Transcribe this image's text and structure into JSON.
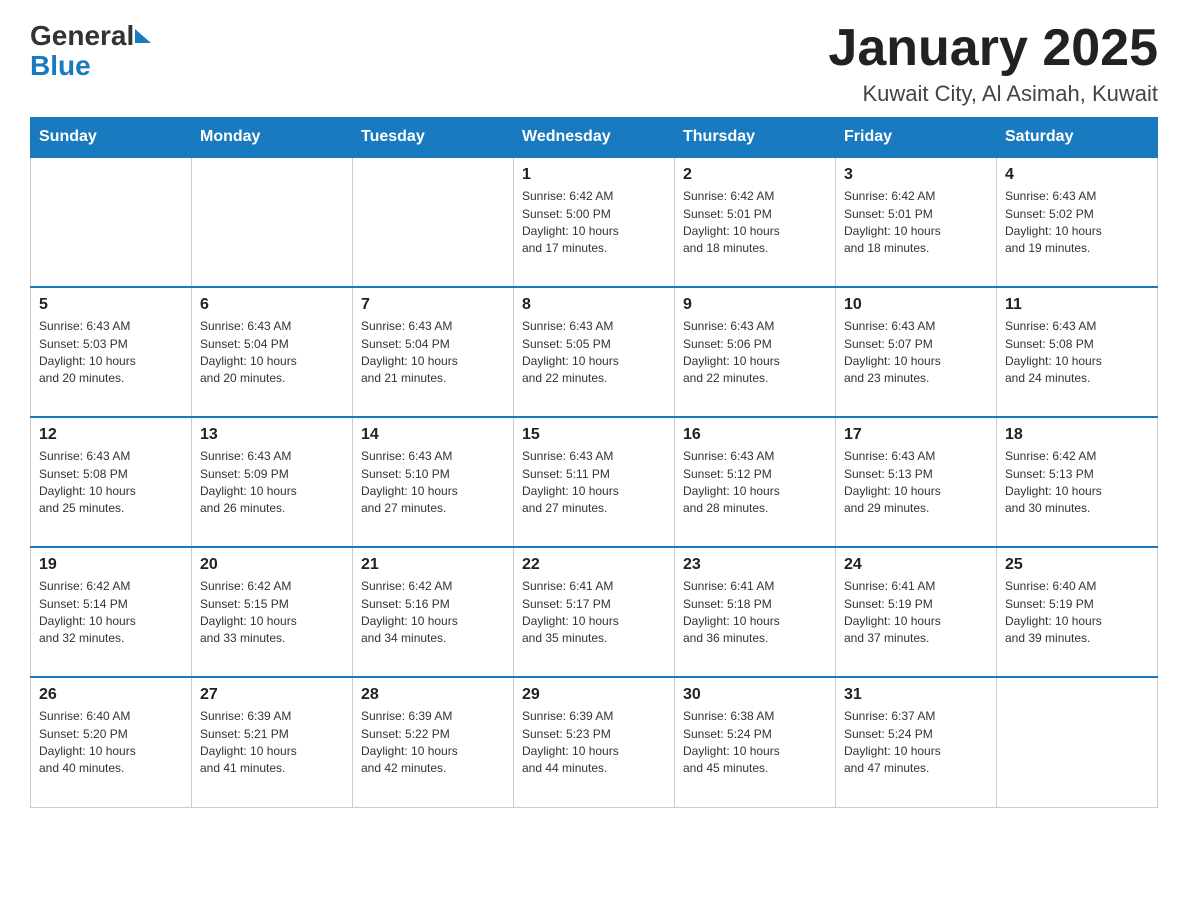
{
  "logo": {
    "text_general": "General",
    "text_blue": "Blue",
    "triangle_alt": "triangle"
  },
  "title": {
    "month": "January 2025",
    "location": "Kuwait City, Al Asimah, Kuwait"
  },
  "days_of_week": [
    "Sunday",
    "Monday",
    "Tuesday",
    "Wednesday",
    "Thursday",
    "Friday",
    "Saturday"
  ],
  "weeks": [
    {
      "cells": [
        {
          "day": "",
          "info": ""
        },
        {
          "day": "",
          "info": ""
        },
        {
          "day": "",
          "info": ""
        },
        {
          "day": "1",
          "info": "Sunrise: 6:42 AM\nSunset: 5:00 PM\nDaylight: 10 hours\nand 17 minutes."
        },
        {
          "day": "2",
          "info": "Sunrise: 6:42 AM\nSunset: 5:01 PM\nDaylight: 10 hours\nand 18 minutes."
        },
        {
          "day": "3",
          "info": "Sunrise: 6:42 AM\nSunset: 5:01 PM\nDaylight: 10 hours\nand 18 minutes."
        },
        {
          "day": "4",
          "info": "Sunrise: 6:43 AM\nSunset: 5:02 PM\nDaylight: 10 hours\nand 19 minutes."
        }
      ]
    },
    {
      "cells": [
        {
          "day": "5",
          "info": "Sunrise: 6:43 AM\nSunset: 5:03 PM\nDaylight: 10 hours\nand 20 minutes."
        },
        {
          "day": "6",
          "info": "Sunrise: 6:43 AM\nSunset: 5:04 PM\nDaylight: 10 hours\nand 20 minutes."
        },
        {
          "day": "7",
          "info": "Sunrise: 6:43 AM\nSunset: 5:04 PM\nDaylight: 10 hours\nand 21 minutes."
        },
        {
          "day": "8",
          "info": "Sunrise: 6:43 AM\nSunset: 5:05 PM\nDaylight: 10 hours\nand 22 minutes."
        },
        {
          "day": "9",
          "info": "Sunrise: 6:43 AM\nSunset: 5:06 PM\nDaylight: 10 hours\nand 22 minutes."
        },
        {
          "day": "10",
          "info": "Sunrise: 6:43 AM\nSunset: 5:07 PM\nDaylight: 10 hours\nand 23 minutes."
        },
        {
          "day": "11",
          "info": "Sunrise: 6:43 AM\nSunset: 5:08 PM\nDaylight: 10 hours\nand 24 minutes."
        }
      ]
    },
    {
      "cells": [
        {
          "day": "12",
          "info": "Sunrise: 6:43 AM\nSunset: 5:08 PM\nDaylight: 10 hours\nand 25 minutes."
        },
        {
          "day": "13",
          "info": "Sunrise: 6:43 AM\nSunset: 5:09 PM\nDaylight: 10 hours\nand 26 minutes."
        },
        {
          "day": "14",
          "info": "Sunrise: 6:43 AM\nSunset: 5:10 PM\nDaylight: 10 hours\nand 27 minutes."
        },
        {
          "day": "15",
          "info": "Sunrise: 6:43 AM\nSunset: 5:11 PM\nDaylight: 10 hours\nand 27 minutes."
        },
        {
          "day": "16",
          "info": "Sunrise: 6:43 AM\nSunset: 5:12 PM\nDaylight: 10 hours\nand 28 minutes."
        },
        {
          "day": "17",
          "info": "Sunrise: 6:43 AM\nSunset: 5:13 PM\nDaylight: 10 hours\nand 29 minutes."
        },
        {
          "day": "18",
          "info": "Sunrise: 6:42 AM\nSunset: 5:13 PM\nDaylight: 10 hours\nand 30 minutes."
        }
      ]
    },
    {
      "cells": [
        {
          "day": "19",
          "info": "Sunrise: 6:42 AM\nSunset: 5:14 PM\nDaylight: 10 hours\nand 32 minutes."
        },
        {
          "day": "20",
          "info": "Sunrise: 6:42 AM\nSunset: 5:15 PM\nDaylight: 10 hours\nand 33 minutes."
        },
        {
          "day": "21",
          "info": "Sunrise: 6:42 AM\nSunset: 5:16 PM\nDaylight: 10 hours\nand 34 minutes."
        },
        {
          "day": "22",
          "info": "Sunrise: 6:41 AM\nSunset: 5:17 PM\nDaylight: 10 hours\nand 35 minutes."
        },
        {
          "day": "23",
          "info": "Sunrise: 6:41 AM\nSunset: 5:18 PM\nDaylight: 10 hours\nand 36 minutes."
        },
        {
          "day": "24",
          "info": "Sunrise: 6:41 AM\nSunset: 5:19 PM\nDaylight: 10 hours\nand 37 minutes."
        },
        {
          "day": "25",
          "info": "Sunrise: 6:40 AM\nSunset: 5:19 PM\nDaylight: 10 hours\nand 39 minutes."
        }
      ]
    },
    {
      "cells": [
        {
          "day": "26",
          "info": "Sunrise: 6:40 AM\nSunset: 5:20 PM\nDaylight: 10 hours\nand 40 minutes."
        },
        {
          "day": "27",
          "info": "Sunrise: 6:39 AM\nSunset: 5:21 PM\nDaylight: 10 hours\nand 41 minutes."
        },
        {
          "day": "28",
          "info": "Sunrise: 6:39 AM\nSunset: 5:22 PM\nDaylight: 10 hours\nand 42 minutes."
        },
        {
          "day": "29",
          "info": "Sunrise: 6:39 AM\nSunset: 5:23 PM\nDaylight: 10 hours\nand 44 minutes."
        },
        {
          "day": "30",
          "info": "Sunrise: 6:38 AM\nSunset: 5:24 PM\nDaylight: 10 hours\nand 45 minutes."
        },
        {
          "day": "31",
          "info": "Sunrise: 6:37 AM\nSunset: 5:24 PM\nDaylight: 10 hours\nand 47 minutes."
        },
        {
          "day": "",
          "info": ""
        }
      ]
    }
  ]
}
